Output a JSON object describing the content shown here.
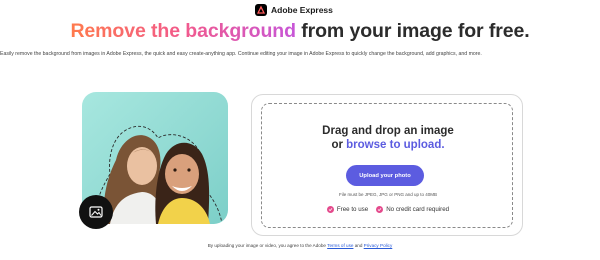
{
  "header": {
    "brand_name": "Adobe Express",
    "brand_icon": "adobe-express-logo-icon"
  },
  "hero": {
    "headline_gradient": "Remove the background",
    "headline_rest": " from your image for free.",
    "gradient_colors": [
      "#ff7a4c",
      "#f25a8c",
      "#c756d8"
    ],
    "subtitle": "Easily remove the background from images in Adobe Express, the quick and easy create-anything app. Continue editing your image in Adobe Express to quickly change the background, add graphics, and more."
  },
  "preview": {
    "photo_icon": "image-icon",
    "background_color": "#9adfd8"
  },
  "upload": {
    "drag_text": "Drag and drop an image",
    "or_text": "or ",
    "browse_text": "browse to upload.",
    "button_label": "Upload your photo",
    "formats_note": "File must be JPEG, JPG or PNG and up to 40MB",
    "perks": [
      "Free to use",
      "No credit card required"
    ],
    "accent_color": "#5c5ce0",
    "check_color": "#e44a8c"
  },
  "footer": {
    "terms_prefix": "By uploading your image or video, you agree to the Adobe ",
    "terms_link": "Terms of use",
    "terms_and": " and ",
    "privacy_link": "Privacy Policy"
  }
}
